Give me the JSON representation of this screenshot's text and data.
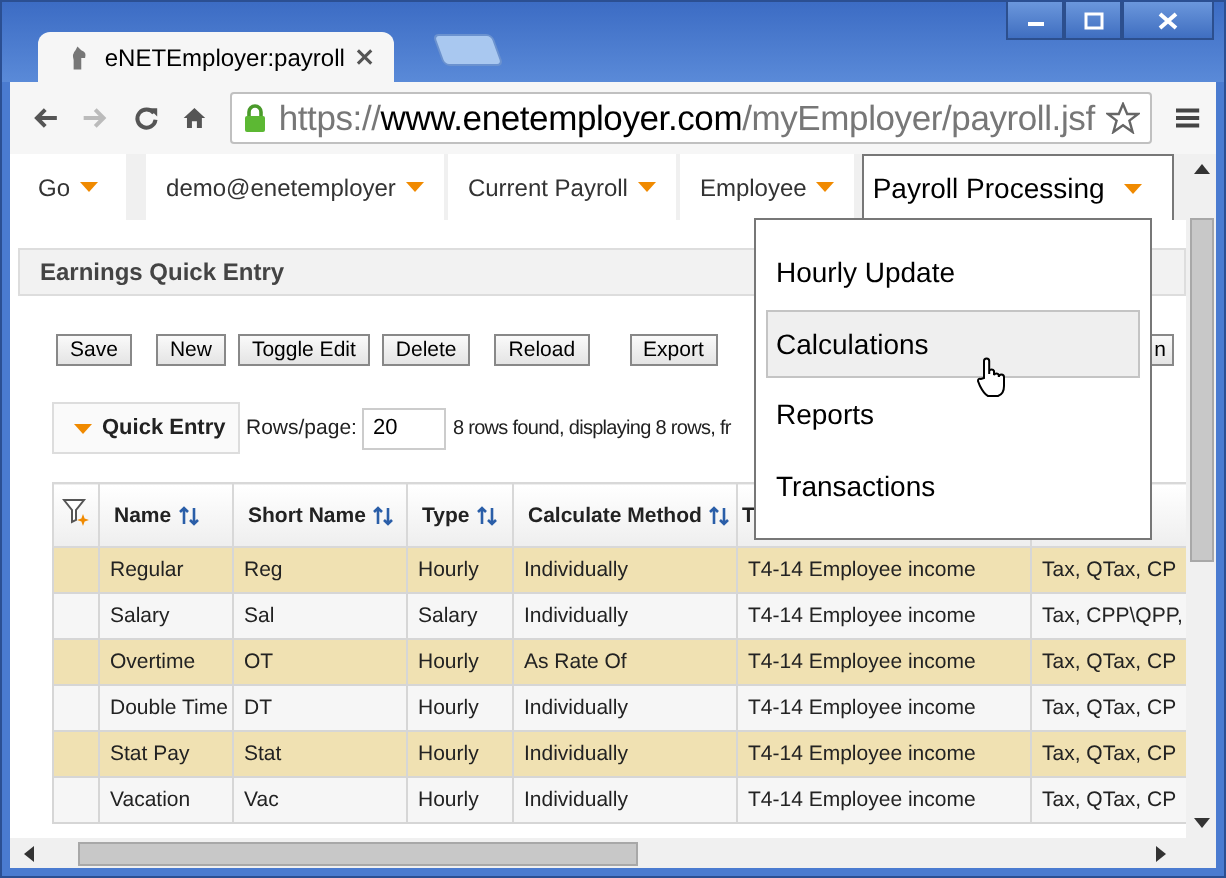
{
  "browser": {
    "tab_title": "eNETEmployer:payroll",
    "url": {
      "scheme": "https://",
      "host": "www.enetemployer.com",
      "path": "/myEmployer/payroll.jsf"
    }
  },
  "nav": [
    {
      "label": "Go",
      "open": false
    },
    {
      "label": "demo@enetemployer",
      "open": false
    },
    {
      "label": "Current Payroll",
      "open": false
    },
    {
      "label": "Employee",
      "open": false
    },
    {
      "label": "Payroll Processing",
      "open": true
    }
  ],
  "menu": [
    {
      "label": "Hourly Update",
      "selected": false
    },
    {
      "label": "Calculations",
      "selected": true
    },
    {
      "label": "Reports",
      "selected": false
    },
    {
      "label": "Transactions",
      "selected": false
    }
  ],
  "panel": {
    "title": "Earnings Quick Entry"
  },
  "buttons": [
    "Save",
    "New",
    "Toggle Edit",
    "Delete",
    "Reload",
    "Export",
    "n"
  ],
  "quick_entry": {
    "label": "Quick Entry",
    "rows_label": "Rows/page:",
    "rows_value": "20",
    "status": "8 rows found, displaying 8 rows, fr"
  },
  "table": {
    "columns": [
      "Name",
      "Short Name",
      "Type",
      "Calculate Method",
      "T"
    ],
    "rows": [
      [
        "Regular",
        "Reg",
        "Hourly",
        "Individually",
        "T4-14 Employee income",
        "Tax, QTax, CP"
      ],
      [
        "Salary",
        "Sal",
        "Salary",
        "Individually",
        "T4-14 Employee income",
        "Tax, CPP\\QPP,"
      ],
      [
        "Overtime",
        "OT",
        "Hourly",
        "As Rate Of",
        "T4-14 Employee income",
        "Tax, QTax, CP"
      ],
      [
        "Double Time",
        "DT",
        "Hourly",
        "Individually",
        "T4-14 Employee income",
        "Tax, QTax, CP"
      ],
      [
        "Stat Pay",
        "Stat",
        "Hourly",
        "Individually",
        "T4-14 Employee income",
        "Tax, QTax, CP"
      ],
      [
        "Vacation",
        "Vac",
        "Hourly",
        "Individually",
        "T4-14 Employee income",
        "Tax, QTax, CP"
      ]
    ]
  }
}
